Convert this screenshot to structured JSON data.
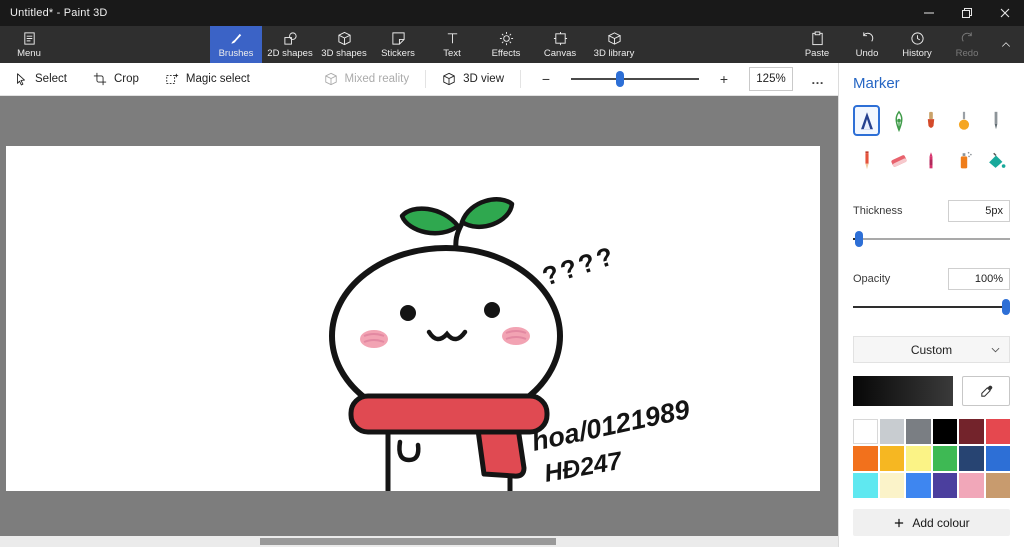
{
  "window": {
    "title": "Untitled* - Paint 3D"
  },
  "ribbon": {
    "menu_label": "Menu",
    "tabs": [
      {
        "label": "Brushes",
        "selected": true
      },
      {
        "label": "2D shapes",
        "selected": false
      },
      {
        "label": "3D shapes",
        "selected": false
      },
      {
        "label": "Stickers",
        "selected": false
      },
      {
        "label": "Text",
        "selected": false
      },
      {
        "label": "Effects",
        "selected": false
      },
      {
        "label": "Canvas",
        "selected": false
      },
      {
        "label": "3D library",
        "selected": false
      }
    ],
    "actions": [
      {
        "label": "Paste",
        "enabled": true
      },
      {
        "label": "Undo",
        "enabled": true
      },
      {
        "label": "History",
        "enabled": true
      },
      {
        "label": "Redo",
        "enabled": false
      }
    ]
  },
  "toolbar": {
    "select": "Select",
    "crop": "Crop",
    "magic_select": "Magic select",
    "mixed_reality": "Mixed reality",
    "view_3d": "3D view",
    "zoom_out": "−",
    "zoom_in": "+",
    "zoom_value": "125%",
    "more": "…"
  },
  "panel": {
    "title": "Marker",
    "brushes": [
      "marker",
      "calligraphy-pen",
      "oil-brush",
      "watercolour",
      "pixel-pen",
      "pencil",
      "eraser",
      "crayon",
      "spray-can",
      "fill"
    ],
    "selected_brush": "marker",
    "thickness_label": "Thickness",
    "thickness_value": "5px",
    "opacity_label": "Opacity",
    "opacity_value": "100%",
    "color_dropdown": "Custom",
    "current_colour": "#000000",
    "palette": [
      "#FFFFFF",
      "#C8CCD0",
      "#7A7E83",
      "#000000",
      "#73232B",
      "#E5484F",
      "#F2711C",
      "#F6B722",
      "#FBF386",
      "#3EB954",
      "#274472",
      "#2D6FD6",
      "#5FE8F0",
      "#FBF3C9",
      "#3E86F0",
      "#4B3F9E",
      "#F1A7B9",
      "#C89B6E"
    ],
    "add_colour": "Add colour"
  },
  "canvas": {
    "question_marks": "????",
    "signature_line1": "hoa/0121989",
    "signature_line2": "HĐ247",
    "colors": {
      "outline": "#141414",
      "sprout_green": "#2fa84f",
      "scarf_red": "#e04a52",
      "blush_pink": "#f2a3b3"
    }
  },
  "theme": {
    "accent_blue": "#3b63c6",
    "panel_title_blue": "#2666c4",
    "slider_blue": "#2d6fd6",
    "workspace_gray": "#7d7d7d"
  }
}
